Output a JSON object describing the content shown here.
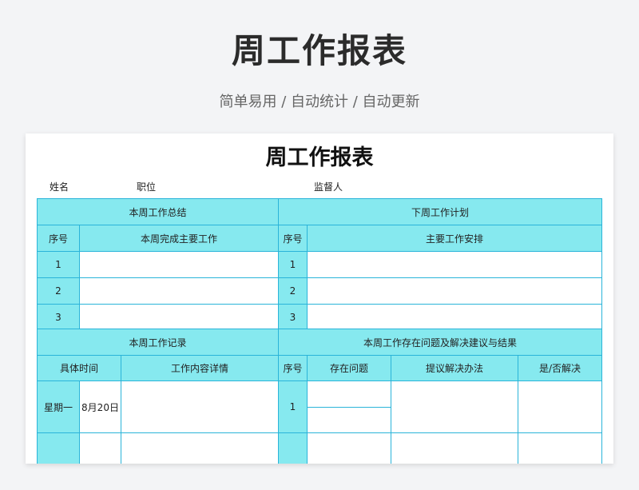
{
  "banner": {
    "title": "周工作报表",
    "subtitle": "简单易用 / 自动统计 / 自动更新"
  },
  "sheet": {
    "title": "周工作报表",
    "meta": {
      "name_label": "姓名",
      "position_label": "职位",
      "supervisor_label": "监督人"
    },
    "summary": {
      "header": "本周工作总结",
      "col_index": "序号",
      "col_main": "本周完成主要工作",
      "rows": [
        "1",
        "2",
        "3"
      ]
    },
    "plan": {
      "header": "下周工作计划",
      "col_index": "序号",
      "col_main": "主要工作安排",
      "rows": [
        "1",
        "2",
        "3"
      ]
    },
    "record": {
      "header": "本周工作记录",
      "col_time": "具体时间",
      "col_detail": "工作内容详情",
      "day": "星期一",
      "date": "8月20日"
    },
    "issues": {
      "header": "本周工作存在问题及解决建议与结果",
      "col_index": "序号",
      "col_problem": "存在问题",
      "col_solution": "提议解决办法",
      "col_resolved": "是/否解决",
      "row1_index": "1"
    }
  }
}
